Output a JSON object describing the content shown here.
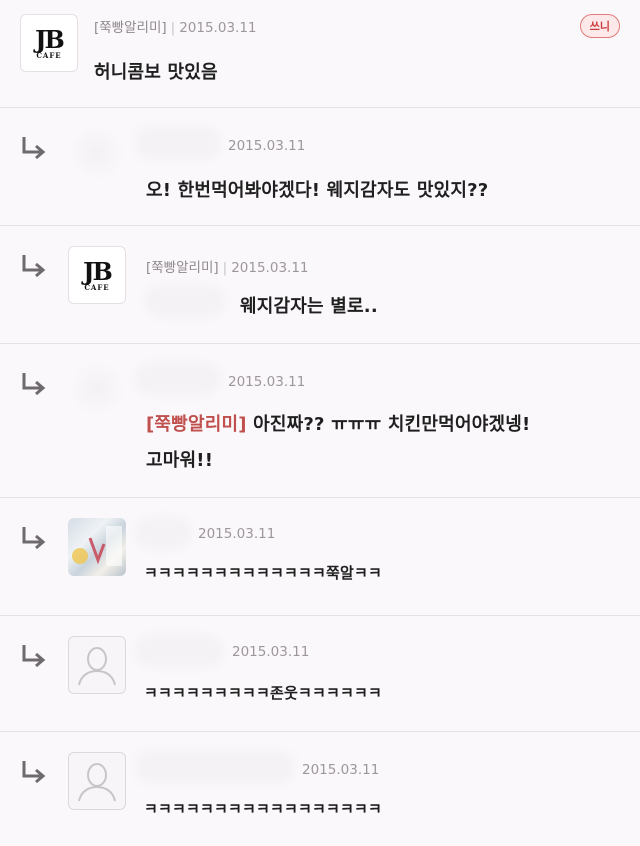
{
  "comments": [
    {
      "nickname": "[쭉빵알리미]",
      "date": "2015.03.11",
      "badge": "쓰니",
      "text": "허니콤보 맛있음",
      "avatar": "jb-cafe-logo",
      "logo_big": "JB",
      "logo_small": "CAFE",
      "is_reply": false
    },
    {
      "nickname": "",
      "date": "2015.03.11",
      "text": "오! 한번먹어봐야겠다! 웨지감자도 맛있지??",
      "avatar": "blurred",
      "is_reply": true
    },
    {
      "nickname": "[쭉빵알리미]",
      "date": "2015.03.11",
      "text": "웨지감자는 별로..",
      "avatar": "jb-cafe-logo",
      "logo_big": "JB",
      "logo_small": "CAFE",
      "is_reply": true
    },
    {
      "nickname": "",
      "date": "2015.03.11",
      "mention": "[쭉빵알리미]",
      "text": " 아진짜?? ㅠㅠㅠ 치킨만먹어야겠넹!",
      "text_line2": "고마워!!",
      "avatar": "blurred",
      "is_reply": true
    },
    {
      "nickname": "",
      "date": "2015.03.11",
      "text": "ㅋㅋㅋㅋㅋㅋㅋㅋㅋㅋㅋㅋㅋ쭉알ㅋㅋ",
      "avatar": "photo",
      "is_reply": true
    },
    {
      "nickname": "",
      "date": "2015.03.11",
      "text": "ㅋㅋㅋㅋㅋㅋㅋㅋㅋ존웃ㅋㅋㅋㅋㅋㅋ",
      "avatar": "default-profile",
      "is_reply": true
    },
    {
      "nickname": "",
      "date": "2015.03.11",
      "text": "ㅋㅋㅋㅋㅋㅋㅋㅋㅋㅋㅋㅋㅋㅋㅋㅋㅋ",
      "avatar": "default-profile",
      "is_reply": true
    }
  ],
  "icons": {
    "reply": "reply-arrow-icon",
    "default_avatar": "person-silhouette-icon"
  },
  "colors": {
    "mention": "#c0504d",
    "badge_border": "#e27b7b",
    "meta": "#9d979d"
  }
}
